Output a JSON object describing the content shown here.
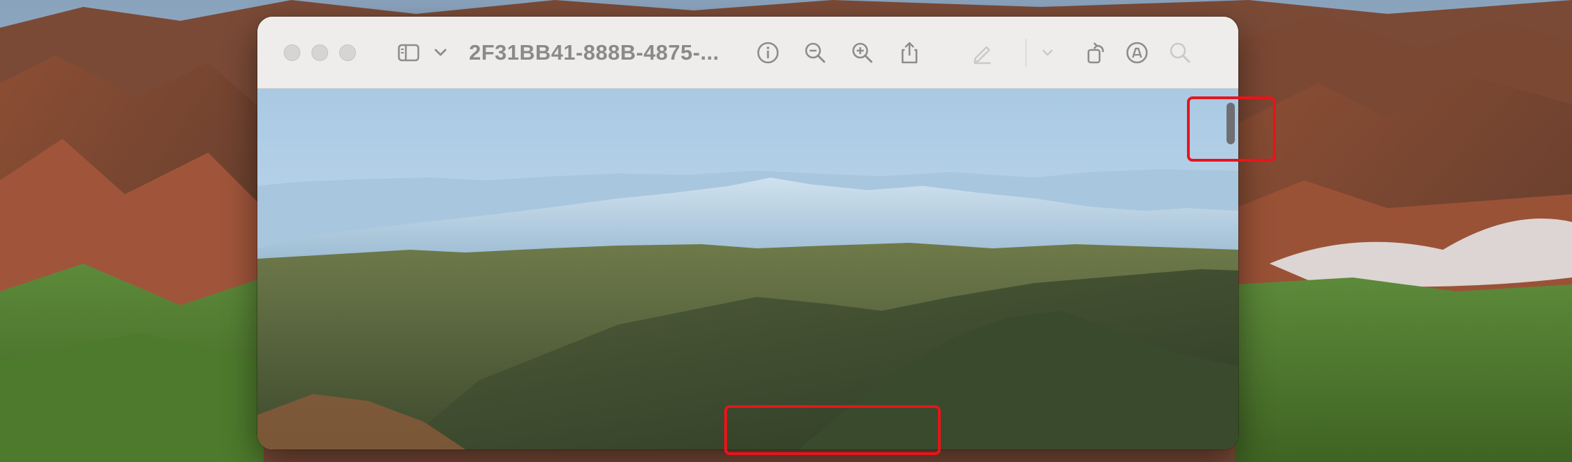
{
  "window": {
    "title": "2F31BB41-888B-4875-...",
    "controls": [
      "close",
      "minimize",
      "zoom"
    ]
  },
  "toolbar": {
    "icons": [
      "sidebar-icon",
      "chevron-down-icon",
      "info-icon",
      "zoom-out-icon",
      "zoom-in-icon",
      "share-icon",
      "markup-pen-icon",
      "chevron-down-icon",
      "rotate-icon",
      "annotate-icon",
      "search-icon"
    ]
  },
  "colors": {
    "highlight": "#e8141b",
    "toolbar_bg": "#eeedec",
    "title_text": "#8a8a8a"
  }
}
